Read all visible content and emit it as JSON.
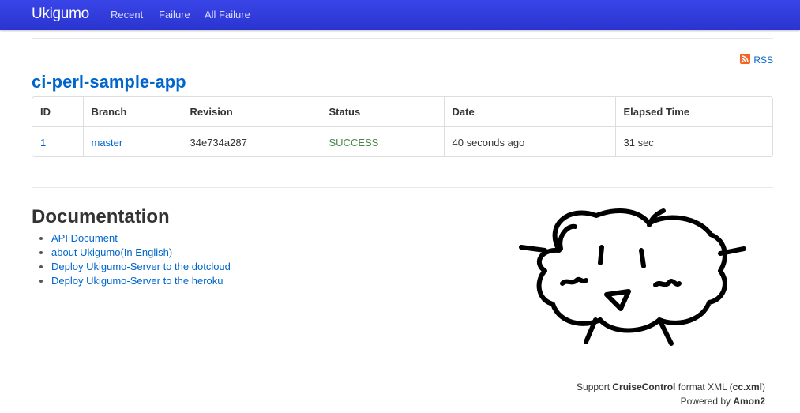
{
  "navbar": {
    "brand": "Ukigumo",
    "links": [
      "Recent",
      "Failure",
      "All Failure"
    ],
    "background_color": "#3138dc"
  },
  "rss": {
    "label": "RSS",
    "icon": "rss-icon",
    "color": "#f26522"
  },
  "project": {
    "title": "ci-perl-sample-app"
  },
  "table": {
    "headers": [
      "ID",
      "Branch",
      "Revision",
      "Status",
      "Date",
      "Elapsed Time"
    ],
    "rows": [
      {
        "id": "1",
        "branch": "master",
        "revision": "34e734a287",
        "status": "SUCCESS",
        "date": "40 seconds ago",
        "elapsed": "31 sec"
      }
    ],
    "status_color": "#468847"
  },
  "documentation": {
    "title": "Documentation",
    "links": [
      "API Document",
      "about Ukigumo(In English)",
      "Deploy Ukigumo-Server to the dotcloud",
      "Deploy Ukigumo-Server to the heroku"
    ]
  },
  "mascot": {
    "icon": "cloud-mascot-drawing"
  },
  "footer": {
    "support_prefix": "Support ",
    "support_brand": "CruiseControl",
    "support_middle": " format XML (",
    "support_link": "cc.xml",
    "support_suffix": ")",
    "powered_prefix": "Powered by ",
    "powered_by": "Amon2"
  },
  "colors": {
    "link": "#0066cc",
    "text": "#333333"
  }
}
